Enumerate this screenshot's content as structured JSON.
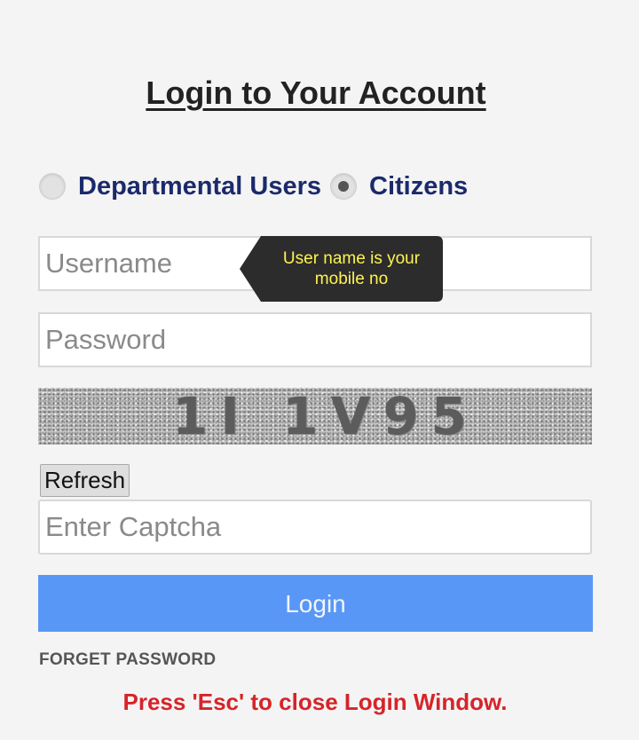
{
  "header": {
    "title": "Login to Your Account"
  },
  "user_type": {
    "options": [
      {
        "label": "Departmental Users",
        "selected": false
      },
      {
        "label": "Citizens",
        "selected": true
      }
    ]
  },
  "form": {
    "username_placeholder": "Username",
    "password_placeholder": "Password",
    "captcha_text": "1I 1V95",
    "refresh_label": "Refresh",
    "captcha_placeholder": "Enter Captcha",
    "login_label": "Login"
  },
  "tooltip": {
    "text": "User name is your mobile no"
  },
  "links": {
    "forget_password": "FORGET PASSWORD"
  },
  "notice": {
    "esc_text": "Press 'Esc' to close Login Window."
  },
  "colors": {
    "login_button": "#5897f5",
    "radio_label": "#1b2a6b",
    "notice_text": "#d6242a",
    "tooltip_bg": "#2c2c2c",
    "tooltip_text": "#fff44f"
  }
}
